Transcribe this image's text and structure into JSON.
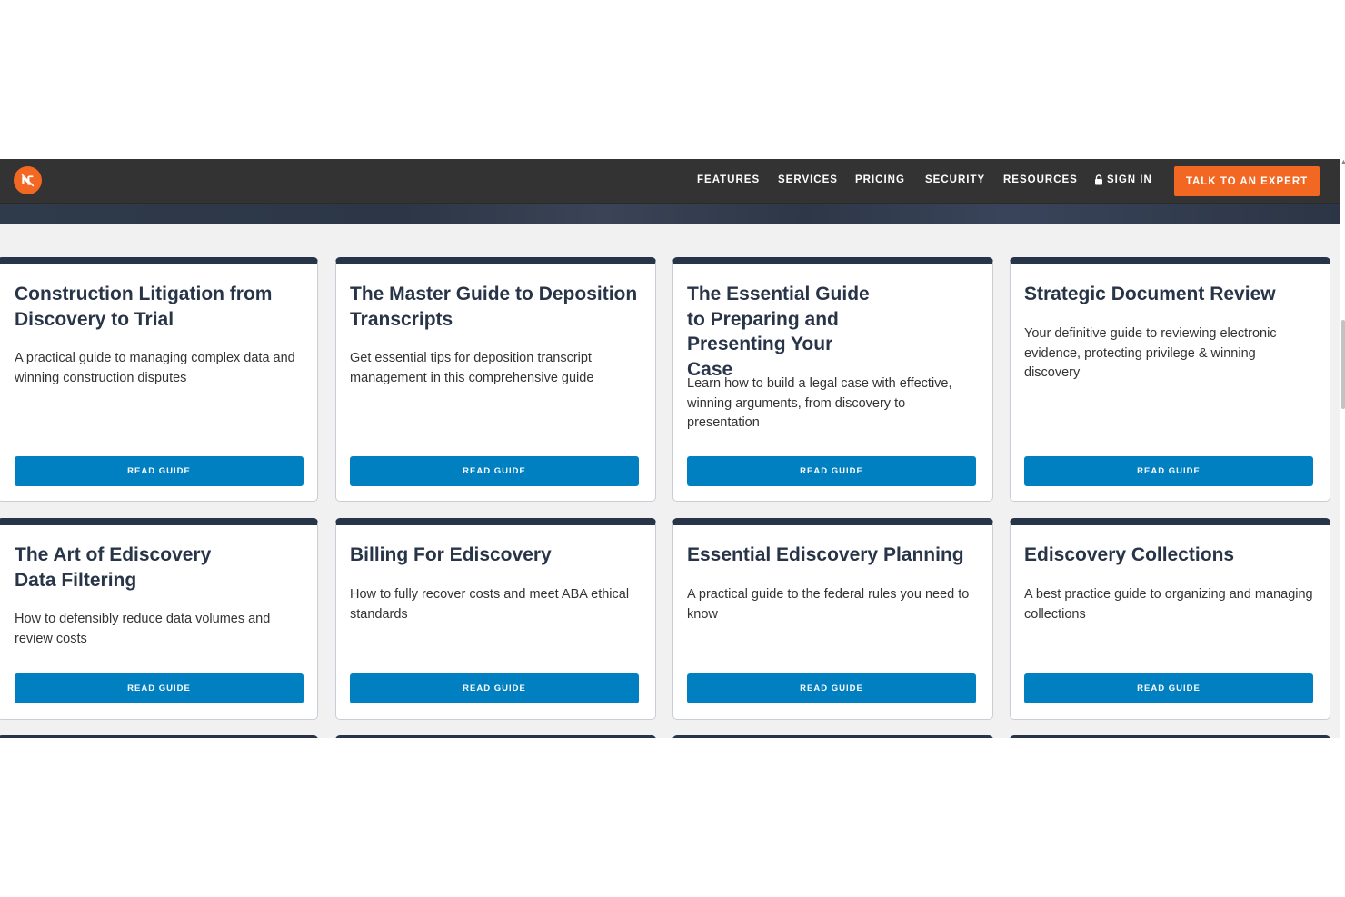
{
  "nav": {
    "items": [
      "FEATURES",
      "SERVICES",
      "PRICING",
      "SECURITY",
      "RESOURCES"
    ],
    "signin": "SIGN IN",
    "cta": "TALK TO AN EXPERT"
  },
  "colors": {
    "navbar": "#333333",
    "accent": "#f26722",
    "card_border_top": "#283447",
    "button": "#0080c0",
    "page_bg": "#f1f1f1"
  },
  "cards": [
    {
      "title": "Construction Litigation from Discovery to Trial",
      "description": "A practical guide to managing complex data and winning construction disputes",
      "button": "READ GUIDE"
    },
    {
      "title": "The Master Guide to Deposition Transcripts",
      "description": "Get essential tips for deposition transcript management in this comprehensive guide",
      "button": "READ GUIDE"
    },
    {
      "title": "The Essential Guide to Preparing and Presenting Your Case",
      "description": "Learn how to build a legal case with effective, winning arguments, from discovery to presentation",
      "button": "READ GUIDE"
    },
    {
      "title": "Strategic Document Review",
      "description": "Your definitive guide to reviewing electronic evidence, protecting privilege & winning discovery",
      "button": "READ GUIDE"
    },
    {
      "title": "The Art of Ediscovery Data Filtering",
      "description": "How to defensibly reduce data volumes and review costs",
      "button": "READ GUIDE"
    },
    {
      "title": "Billing For Ediscovery",
      "description": "How to fully recover costs and meet ABA ethical standards",
      "button": "READ GUIDE"
    },
    {
      "title": "Essential Ediscovery Planning",
      "description": "A practical guide to the federal rules you need to know",
      "button": "READ GUIDE"
    },
    {
      "title": "Ediscovery Collections",
      "description": "A best practice guide to organizing and managing collections",
      "button": "READ GUIDE"
    }
  ]
}
